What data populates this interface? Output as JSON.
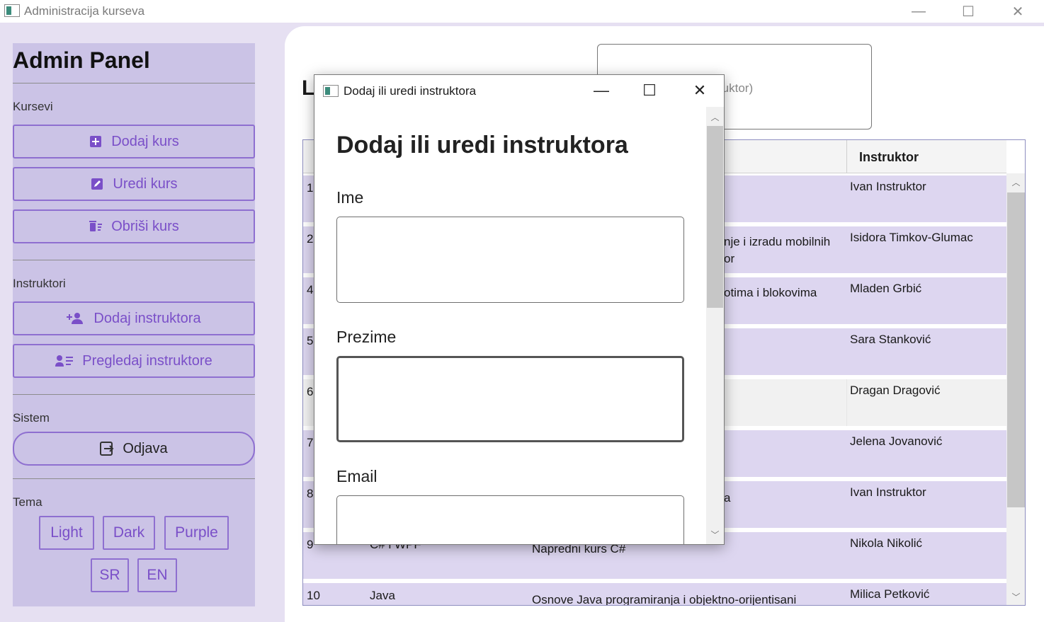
{
  "window": {
    "title": "Administracija kurseva",
    "minimize": "—",
    "maximize": "☐",
    "close": "✕"
  },
  "sidebar": {
    "title": "Admin Panel",
    "courses_label": "Kursevi",
    "add_course": "Dodaj kurs",
    "edit_course": "Uredi kurs",
    "delete_course": "Obriši kurs",
    "instructors_label": "Instruktori",
    "add_instructor": "Dodaj instruktora",
    "view_instructors": "Pregledaj instruktore",
    "system_label": "Sistem",
    "logout": "Odjava",
    "theme_label": "Tema",
    "theme_light": "Light",
    "theme_dark": "Dark",
    "theme_purple": "Purple",
    "lang_sr": "SR",
    "lang_en": "EN"
  },
  "main": {
    "title_fragment": "L",
    "search_placeholder_fragment": "ruktor)"
  },
  "grid": {
    "instructor_header": "Instruktor",
    "rows": [
      {
        "id": "1",
        "name": "",
        "desc": "",
        "instructor": "Ivan Instruktor"
      },
      {
        "id": "2",
        "name": "",
        "desc": "nje i izradu mobilnih",
        "desc2": "or",
        "instructor": "Isidora Timkov-Glumac"
      },
      {
        "id": "4",
        "name": "",
        "desc": "otima i blokovima",
        "instructor": "Mladen Grbić"
      },
      {
        "id": "5",
        "name": "",
        "desc": "",
        "instructor": "Sara Stanković"
      },
      {
        "id": "6",
        "name": "",
        "desc": "",
        "instructor": "Dragan Dragović"
      },
      {
        "id": "7",
        "name": "",
        "desc": "",
        "instructor": "Jelena Jovanović"
      },
      {
        "id": "8",
        "name": "",
        "desc": "a",
        "instructor": "Ivan Instruktor"
      },
      {
        "id": "9",
        "name": "C# i WPF",
        "desc": "Napredni kurs C#",
        "instructor": "Nikola Nikolić"
      },
      {
        "id": "10",
        "name": "Java",
        "desc": "Osnove Java programiranja i objektno-orijentisani",
        "instructor": "Milica Petković"
      }
    ]
  },
  "dialog": {
    "window_title": "Dodaj ili uredi instruktora",
    "heading": "Dodaj ili uredi instruktora",
    "first_name_label": "Ime",
    "last_name_label": "Prezime",
    "email_label": "Email",
    "first_name_value": "",
    "last_name_value": "",
    "email_value": ""
  }
}
